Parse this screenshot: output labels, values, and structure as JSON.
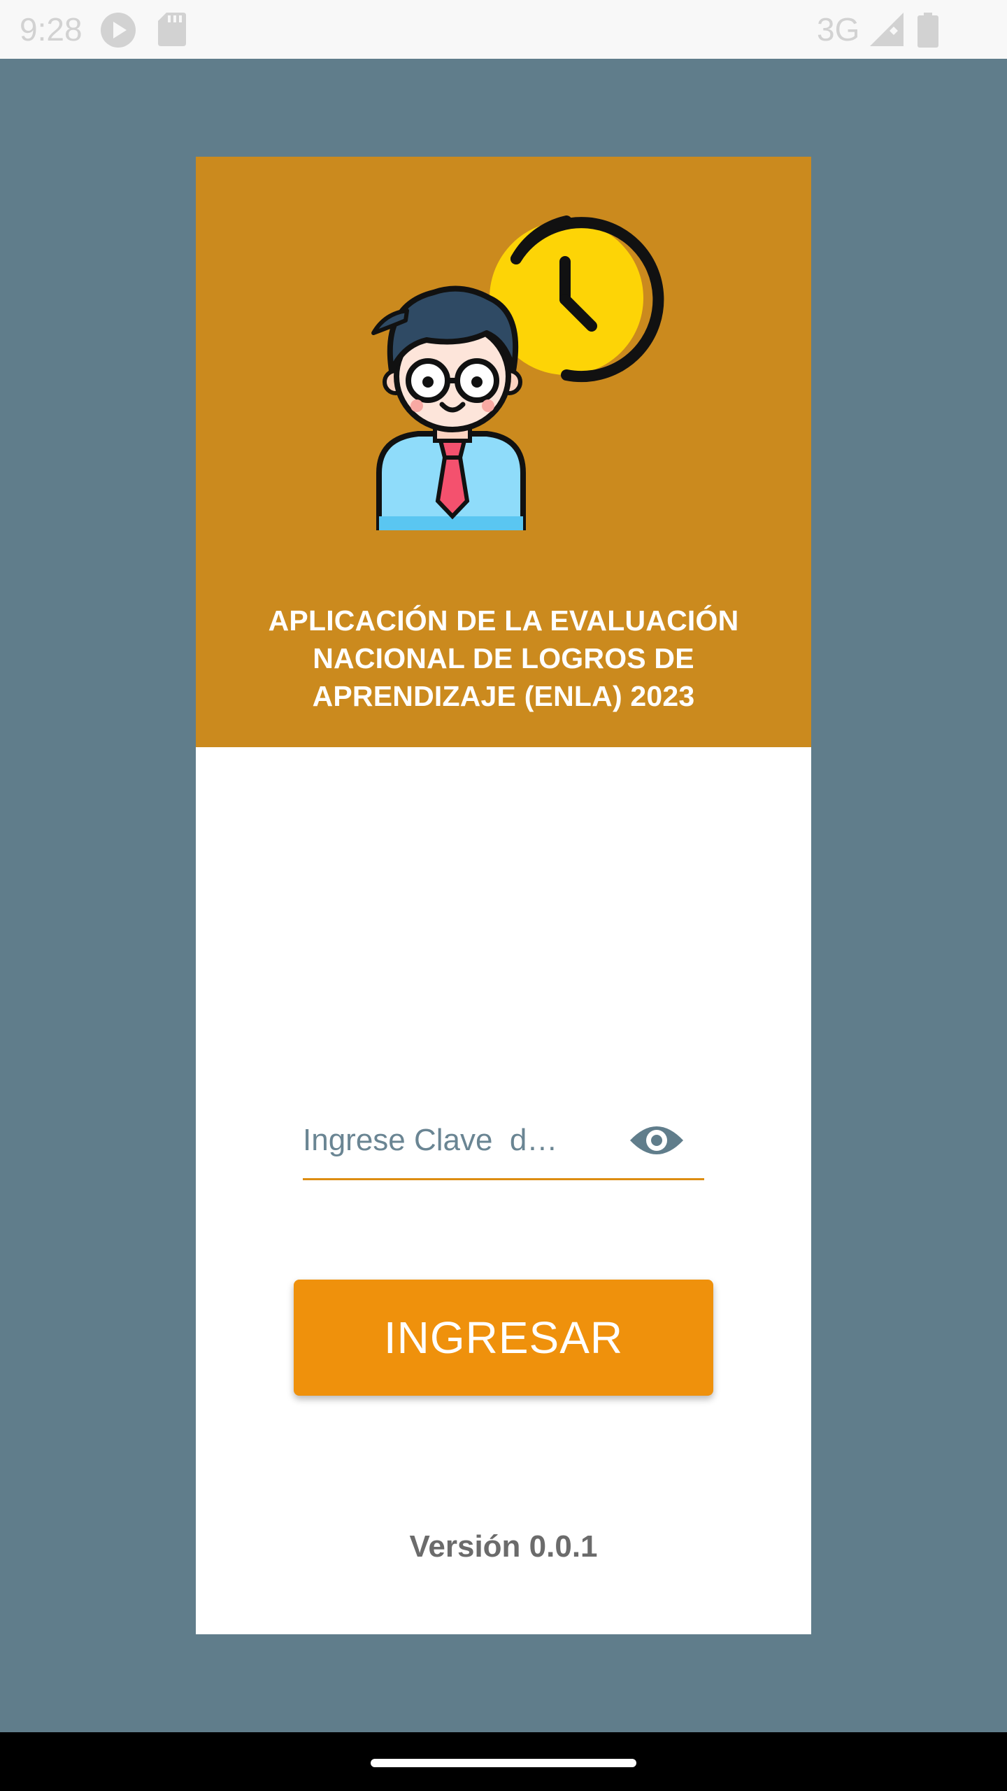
{
  "status_bar": {
    "time": "9:28",
    "network": "3G",
    "icons": [
      "play-icon",
      "sd-card-icon",
      "signal-icon",
      "battery-icon"
    ]
  },
  "header": {
    "title": "APLICACIÓN DE LA EVALUACIÓN NACIONAL DE LOGROS DE APRENDIZAJE (ENLA) 2023",
    "illustration": "teacher-with-clock-icon"
  },
  "form": {
    "password_placeholder": "Ingrese Clave  d…",
    "password_value": "",
    "toggle_icon": "eye-icon"
  },
  "actions": {
    "login_label": "INGRESAR"
  },
  "footer": {
    "version": "Versión 0.0.1"
  },
  "colors": {
    "background": "#607d8b",
    "header": "#cb8a1e",
    "accent": "#ef910c",
    "input_underline": "#dd8d12",
    "text_muted": "#6b6b6b"
  }
}
